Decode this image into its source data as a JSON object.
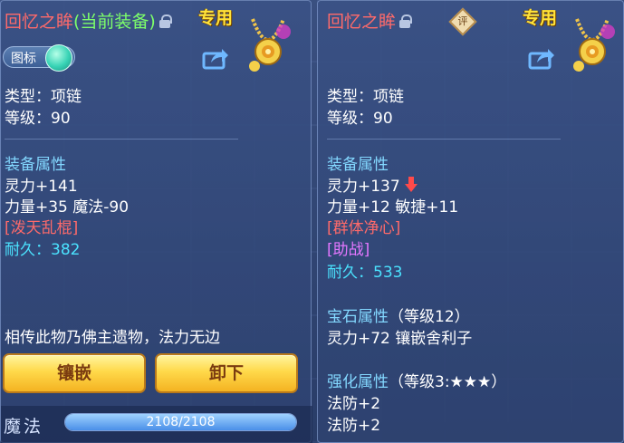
{
  "left_panel": {
    "title": "回忆之眸",
    "equipped_tag": "(当前装备)",
    "exclusive": "专用",
    "icon_toggle_label": "图标",
    "type_line": "类型：项链",
    "level_line": "等级：90",
    "attr_header": "装备属性",
    "attr_1": "灵力+141",
    "attr_2": "力量+35 魔法-90",
    "special_skill": "[泼天乱棍]",
    "durability_label": "耐久：",
    "durability_value": "382",
    "description": "相传此物乃佛主遗物，法力无边",
    "inlay_button": "镶嵌",
    "unequip_button": "卸下",
    "mp_label": "魔法",
    "mp_text": "2108/2108",
    "mp_fraction": 1.0
  },
  "right_panel": {
    "title": "回忆之眸",
    "rate_badge": "评",
    "exclusive": "专用",
    "type_line": "类型：项链",
    "level_line": "等级：90",
    "attr_header": "装备属性",
    "attr_1": "灵力+137",
    "attr_2": "力量+12 敏捷+11",
    "special_skill": "[群体净心]",
    "special_effect": "[助战]",
    "durability_label": "耐久：",
    "durability_value": "533",
    "gem_header": "宝石属性",
    "gem_level": "（等级12）",
    "gem_attr": "灵力+72 镶嵌舍利子",
    "enhance_header": "强化属性",
    "enhance_level": "（等级3:★★★）",
    "enhance_1": "法防+2",
    "enhance_2": "法防+2"
  },
  "colors": {
    "title_red": "#ff6a6a",
    "equipped_green": "#7dff6a",
    "header_blue": "#83d8ff",
    "durability_cyan": "#4be3ff",
    "help_purple": "#e477ff",
    "button_gold": "#ffd94a"
  }
}
